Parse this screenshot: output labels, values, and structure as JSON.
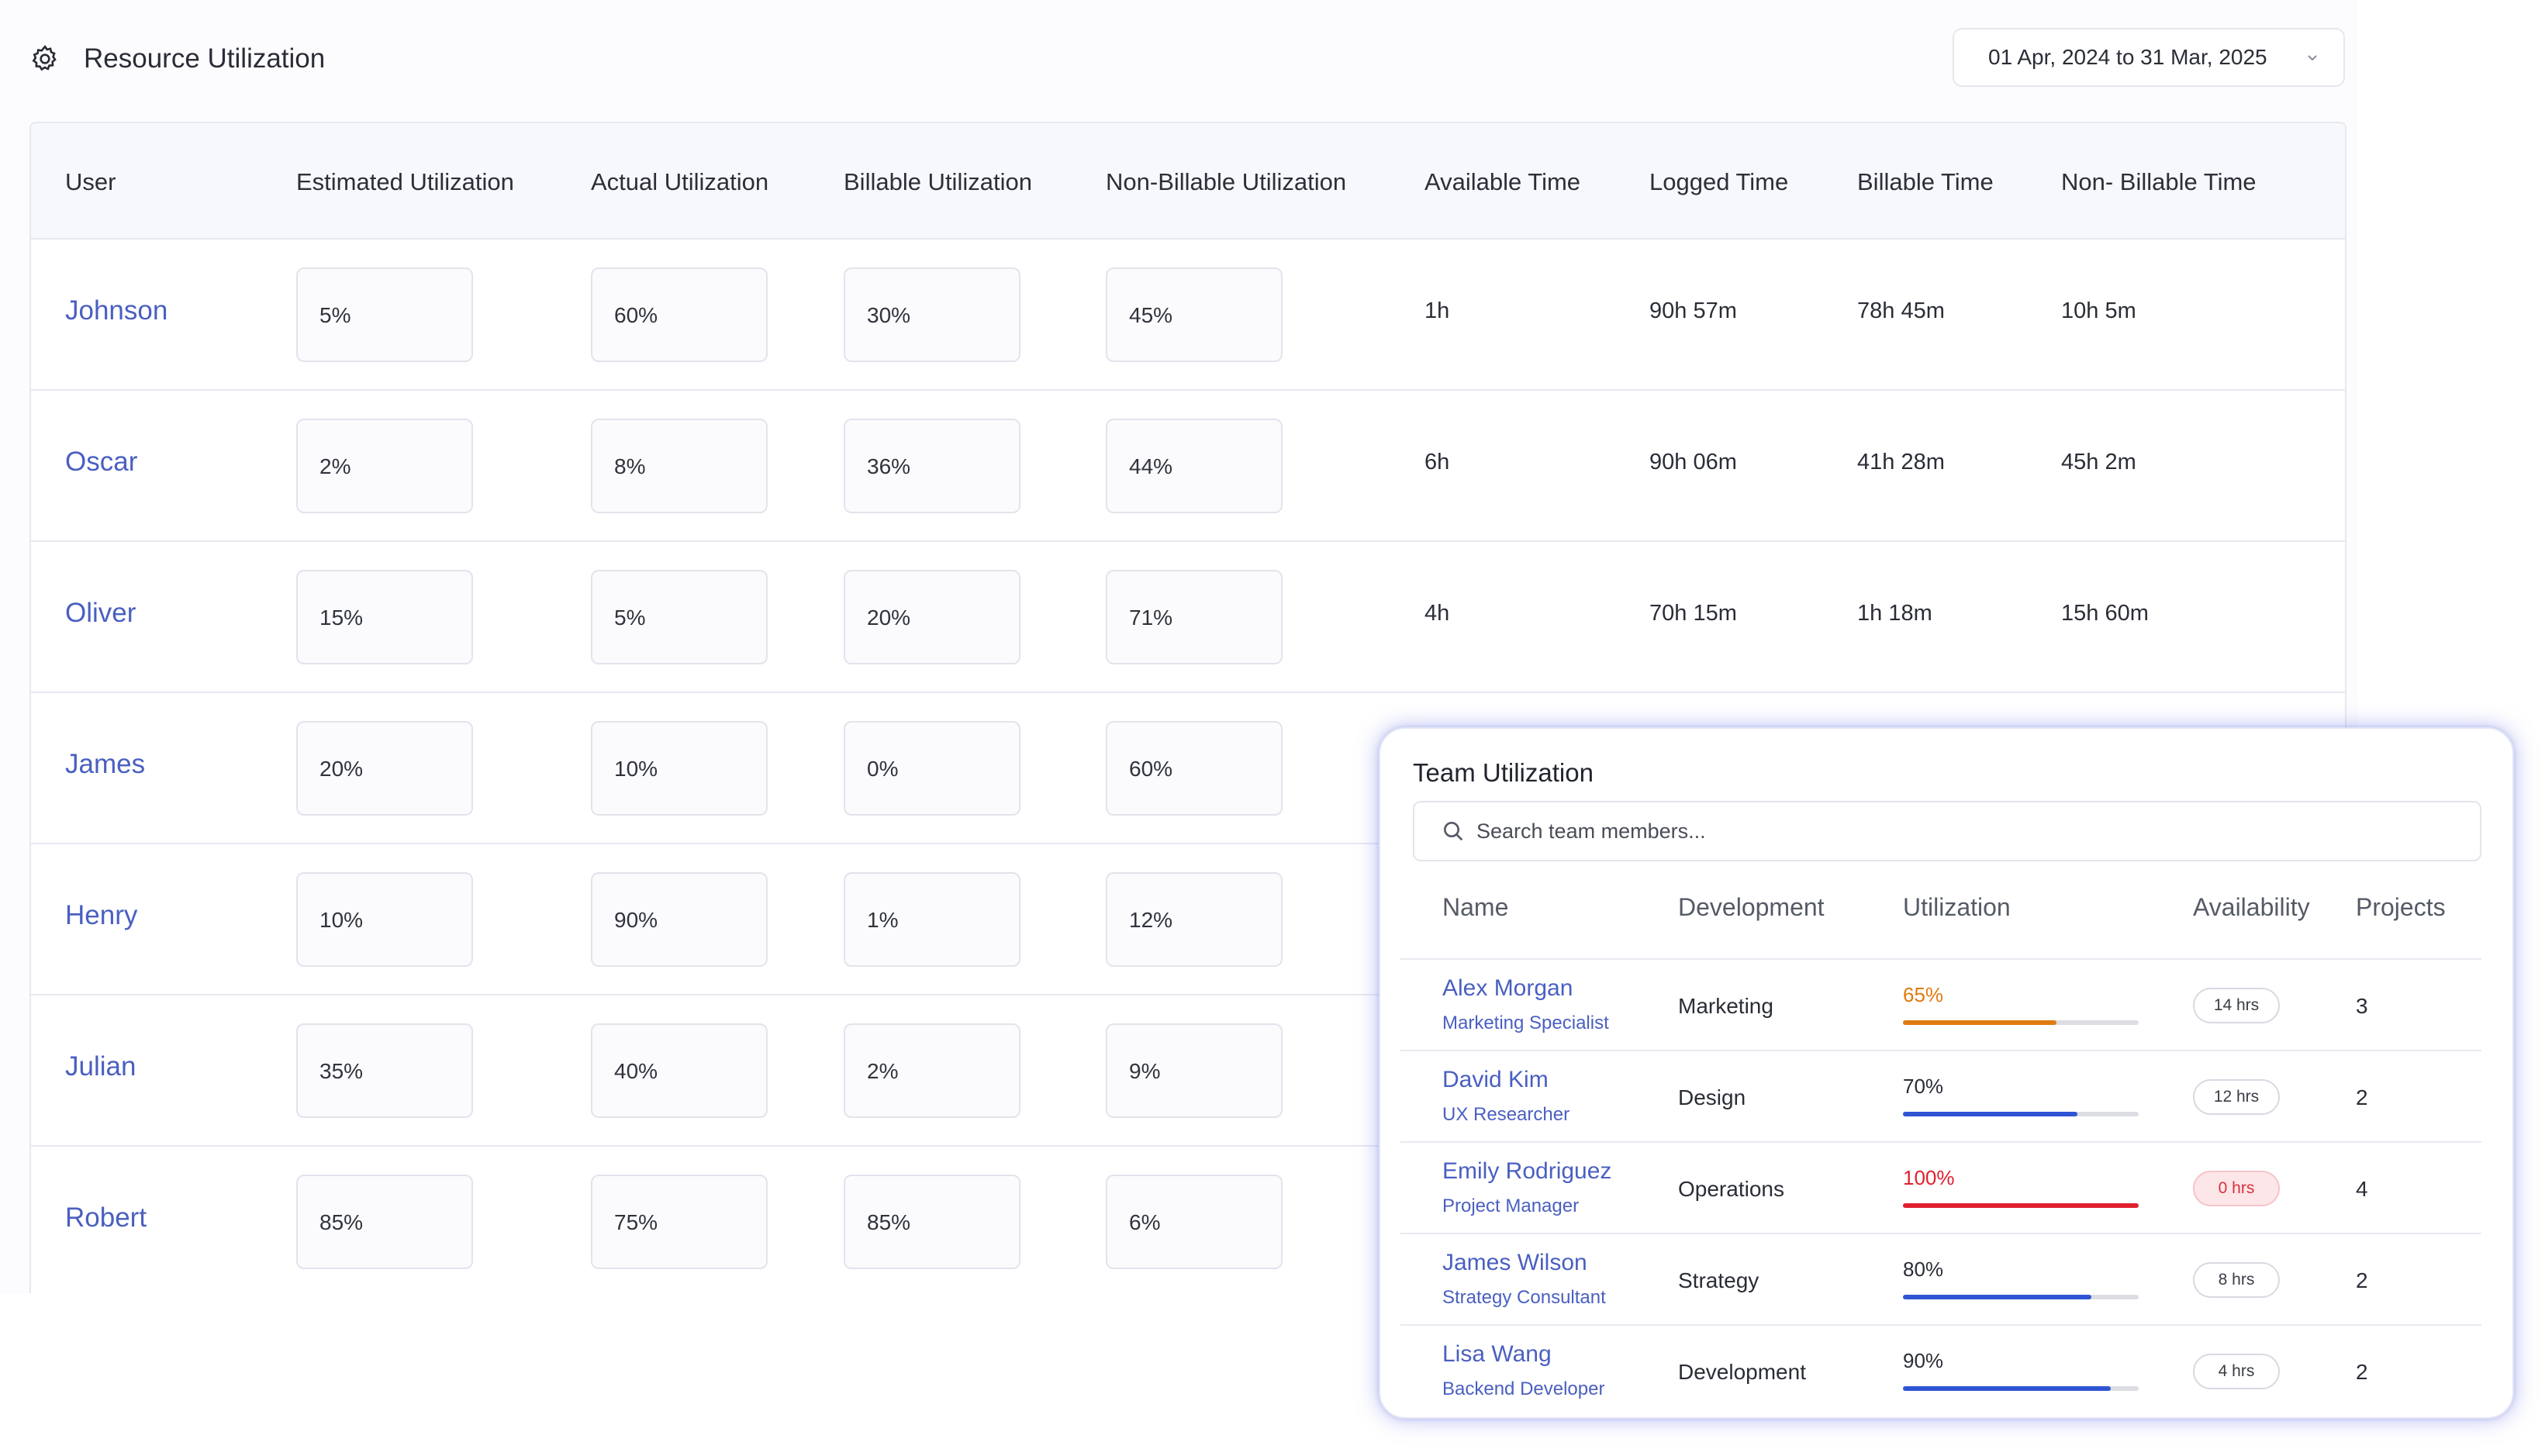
{
  "header": {
    "title": "Resource Utilization",
    "icon": "gear-icon"
  },
  "date_range": {
    "label": "01 Apr, 2024 to 31 Mar, 2025"
  },
  "table": {
    "columns": [
      "User",
      "Estimated Utilization",
      "Actual Utilization",
      "Billable Utilization",
      "Non-Billable Utilization",
      "Available Time",
      "Logged Time",
      "Billable Time",
      "Non- Billable Time"
    ],
    "rows": [
      {
        "user": "Johnson",
        "estimated": "5%",
        "actual": "60%",
        "billable": "30%",
        "non_billable": "45%",
        "available": "1h",
        "logged": "90h 57m",
        "billable_time": "78h 45m",
        "non_billable_time": "10h 5m"
      },
      {
        "user": "Oscar",
        "estimated": "2%",
        "actual": "8%",
        "billable": "36%",
        "non_billable": "44%",
        "available": "6h",
        "logged": "90h 06m",
        "billable_time": "41h 28m",
        "non_billable_time": "45h 2m"
      },
      {
        "user": "Oliver",
        "estimated": "15%",
        "actual": "5%",
        "billable": "20%",
        "non_billable": "71%",
        "available": "4h",
        "logged": "70h 15m",
        "billable_time": "1h 18m",
        "non_billable_time": "15h 60m"
      },
      {
        "user": "James",
        "estimated": "20%",
        "actual": "10%",
        "billable": "0%",
        "non_billable": "60%"
      },
      {
        "user": "Henry",
        "estimated": "10%",
        "actual": "90%",
        "billable": "1%",
        "non_billable": "12%"
      },
      {
        "user": "Julian",
        "estimated": "35%",
        "actual": "40%",
        "billable": "2%",
        "non_billable": "9%"
      },
      {
        "user": "Robert",
        "estimated": "85%",
        "actual": "75%",
        "billable": "85%",
        "non_billable": "6%"
      }
    ]
  },
  "team_panel": {
    "title": "Team Utilization",
    "search_placeholder": "Search team members...",
    "columns": [
      "Name",
      "Development",
      "Utilization",
      "Availability",
      "Projects"
    ],
    "members": [
      {
        "name": "Alex Morgan",
        "role": "Marketing Specialist",
        "department": "Marketing",
        "utilization": "65%",
        "utilization_value": 0.65,
        "bar_color": "#e07a10",
        "text_color": "#e07a10",
        "availability": "14 hrs",
        "alert": false,
        "projects": "3"
      },
      {
        "name": "David Kim",
        "role": "UX Researcher",
        "department": "Design",
        "utilization": "70%",
        "utilization_value": 0.74,
        "bar_color": "#2f55d4",
        "text_color": "#2a2d36",
        "availability": "12 hrs",
        "alert": false,
        "projects": "2"
      },
      {
        "name": "Emily Rodriguez",
        "role": "Project Manager",
        "department": "Operations",
        "utilization": "100%",
        "utilization_value": 1.0,
        "bar_color": "#e0202e",
        "text_color": "#e0202e",
        "availability": "0 hrs",
        "alert": true,
        "projects": "4"
      },
      {
        "name": "James Wilson",
        "role": "Strategy Consultant",
        "department": "Strategy",
        "utilization": "80%",
        "utilization_value": 0.8,
        "bar_color": "#2f55d4",
        "text_color": "#2a2d36",
        "availability": "8 hrs",
        "alert": false,
        "projects": "2"
      },
      {
        "name": "Lisa Wang",
        "role": "Backend Developer",
        "department": "Development",
        "utilization": "90%",
        "utilization_value": 0.88,
        "bar_color": "#2f55d4",
        "text_color": "#2a2d36",
        "availability": "4 hrs",
        "alert": false,
        "projects": "2"
      }
    ]
  }
}
